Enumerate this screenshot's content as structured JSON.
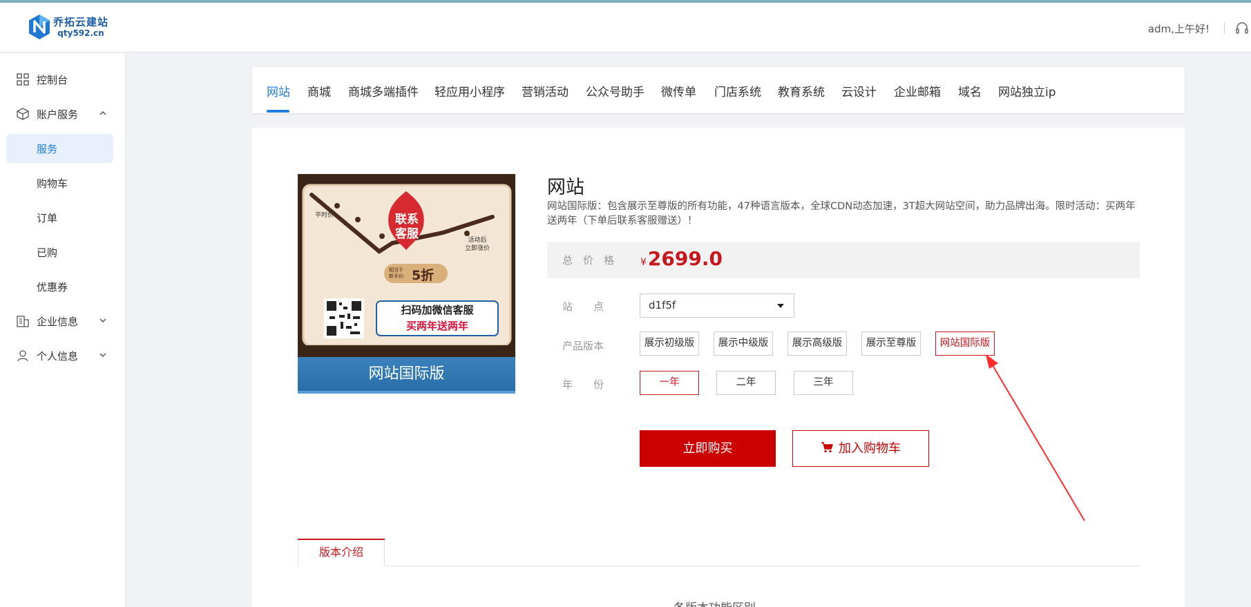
{
  "header": {
    "logo_name": "乔拓云建站",
    "logo_domain": "qty592.cn",
    "greeting": "adm,上午好!",
    "support_icon": "headset-icon"
  },
  "sidebar": {
    "items": [
      {
        "label": "控制台",
        "icon": "grid-icon"
      },
      {
        "label": "账户服务",
        "icon": "box-icon",
        "expanded": true
      },
      {
        "label": "服务",
        "active": true
      },
      {
        "label": "购物车"
      },
      {
        "label": "订单"
      },
      {
        "label": "已购"
      },
      {
        "label": "优惠券"
      },
      {
        "label": "企业信息",
        "icon": "building-icon"
      },
      {
        "label": "个人信息",
        "icon": "user-icon"
      }
    ]
  },
  "tabs": [
    "网站",
    "商城",
    "商城多端插件",
    "轻应用小程序",
    "营销活动",
    "公众号助手",
    "微传单",
    "门店系统",
    "教育系统",
    "云设计",
    "企业邮箱",
    "域名",
    "网站独立ip"
  ],
  "active_tab": "网站",
  "promo": {
    "flame_text_1": "联系",
    "flame_text_2": "客服",
    "left_label": "平时价",
    "right_label_1": "活动后",
    "right_label_2": "立即涨价",
    "badge_small_1": "相当于",
    "badge_small_2": "新手价:",
    "badge_big": "5折",
    "scan_line_1": "扫码加微信客服",
    "scan_line_2": "买两年送两年",
    "banner": "网站国际版"
  },
  "product": {
    "title": "网站",
    "description": "网站国际版：包含展示至尊版的所有功能，47种语言版本，全球CDN动态加速，3T超大网站空间，助力品牌出海。限时活动：买两年送两年（下单后联系客服赠送）！",
    "price_label": "总　价　格",
    "currency": "¥",
    "price": "2699.0",
    "site_label": "站　　点",
    "site_value": "d1f5f",
    "version_label": "产品版本",
    "versions": [
      "展示初级版",
      "展示中级版",
      "展示高级版",
      "展示至尊版",
      "网站国际版"
    ],
    "selected_version": "网站国际版",
    "year_label": "年　　份",
    "years": [
      "一年",
      "二年",
      "三年"
    ],
    "selected_year": "一年",
    "buy_label": "立即购买",
    "cart_label": "加入购物车"
  },
  "details": {
    "tab_label": "版本介绍",
    "section_heading": "各版本功能区别"
  },
  "colors": {
    "accent_blue": "#1d7de2",
    "accent_red": "#cc0000"
  }
}
